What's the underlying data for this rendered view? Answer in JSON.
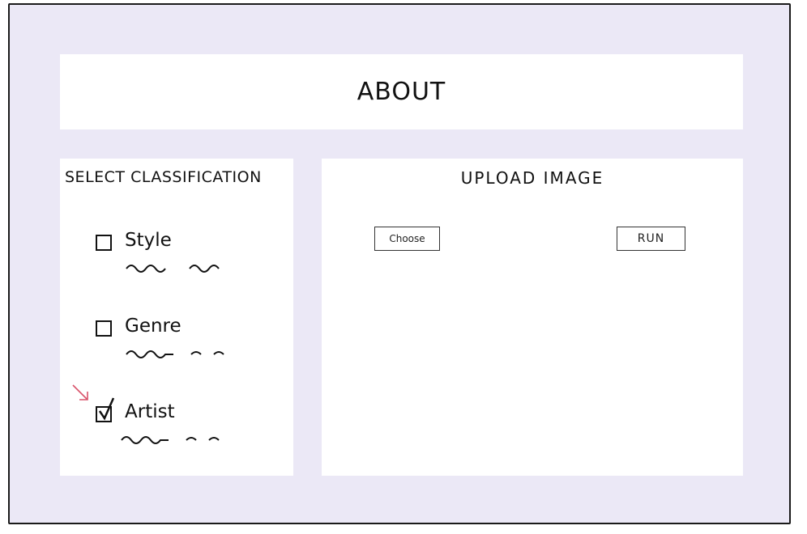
{
  "header": {
    "title": "ABOUT"
  },
  "classification": {
    "heading": "SELECT CLASSIFICATION",
    "options": [
      {
        "label": "Style",
        "checked": false
      },
      {
        "label": "Genre",
        "checked": false
      },
      {
        "label": "Artist",
        "checked": true
      }
    ]
  },
  "upload": {
    "heading": "UPLOAD IMAGE",
    "choose_label": "Choose",
    "run_label": "RUN"
  },
  "colors": {
    "background": "#ebe8f6",
    "panel": "#ffffff",
    "arrow": "#d9536b"
  },
  "icons": {
    "selection_arrow": "arrow-pointer-icon",
    "check": "checkmark-icon"
  }
}
